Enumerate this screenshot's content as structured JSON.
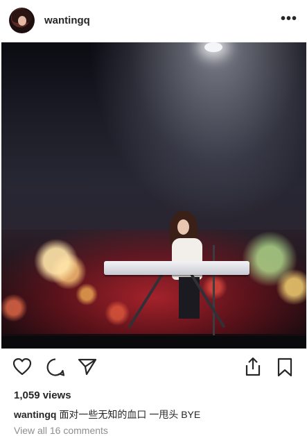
{
  "post": {
    "username": "wantingq",
    "more_icon": "ellipsis-horizontal-icon",
    "views": "1,059 views",
    "caption_user": "wantingq",
    "caption_text": "面对一些无知的血口 一甩头 BYE",
    "view_comments": "View all 16 comments"
  },
  "actions": {
    "like_icon": "heart-outline-icon",
    "comment_icon": "comment-bubble-icon",
    "share_icon": "paper-plane-icon",
    "upload_icon": "share-upload-icon",
    "save_icon": "bookmark-icon"
  },
  "colors": {
    "text": "#262626",
    "muted": "#8e8e8e",
    "background": "#ffffff"
  }
}
